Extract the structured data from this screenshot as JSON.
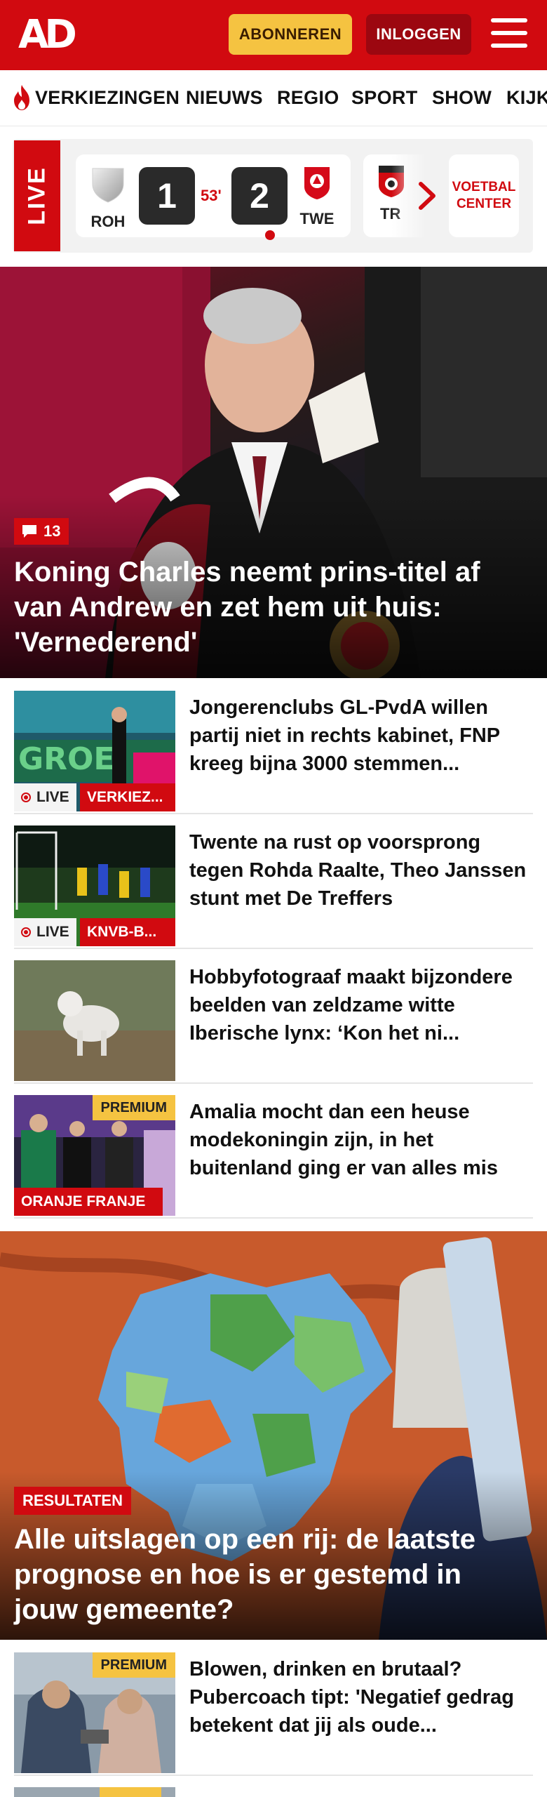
{
  "header": {
    "logo_text": "AD",
    "subscribe_label": "ABONNEREN",
    "login_label": "INLOGGEN",
    "menu_icon": "hamburger-menu-icon"
  },
  "nav": {
    "items": [
      "VERKIEZINGEN",
      "NIEUWS",
      "REGIO",
      "SPORT",
      "SHOW",
      "KIJK"
    ]
  },
  "live": {
    "label": "LIVE",
    "match": {
      "home_code": "ROH",
      "away_code": "TWE",
      "home_score": "1",
      "away_score": "2",
      "minute": "53'"
    },
    "next_team_code": "TR",
    "center_label_1": "VOETBAL",
    "center_label_2": "CENTER"
  },
  "hero": {
    "comment_count": "13",
    "title": "Koning Charles neemt prins-titel af van Andrew en zet hem uit huis: 'Vernederend'"
  },
  "articles": [
    {
      "title": "Jongerenclubs GL-PvdA willen partij niet in rechts kabinet, FNP kreeg bijna 3000 stemmen...",
      "live_label": "LIVE",
      "category": "VERKIEZ..."
    },
    {
      "title": "Twente na rust op voorsprong tegen Rohda Raalte, Theo Janssen stunt met De Treffers",
      "live_label": "LIVE",
      "category": "KNVB-B..."
    },
    {
      "title": "Hobbyfotograaf maakt bijzondere beelden van zeldzame witte Iberische lynx: ‘Kon het ni..."
    },
    {
      "title": "Amalia mocht dan een heuse modekoningin zijn, in het buitenland ging er van alles mis",
      "premium_label": "PREMIUM",
      "category": "ORANJE FRANJE"
    }
  ],
  "feature": {
    "tag": "RESULTATEN",
    "title": "Alle uitslagen op een rij: de laatste prognose en hoe is er gestemd in jouw gemeente?"
  },
  "bottom_articles": [
    {
      "title": "Blowen, drinken en brutaal? Pubercoach tipt: 'Negatief gedrag betekent dat jij als oude...",
      "premium_label": "PREMIUM"
    }
  ],
  "colors": {
    "brand_red": "#d10a10",
    "premium_yellow": "#f5c341",
    "login_dark_red": "#9c0710"
  }
}
